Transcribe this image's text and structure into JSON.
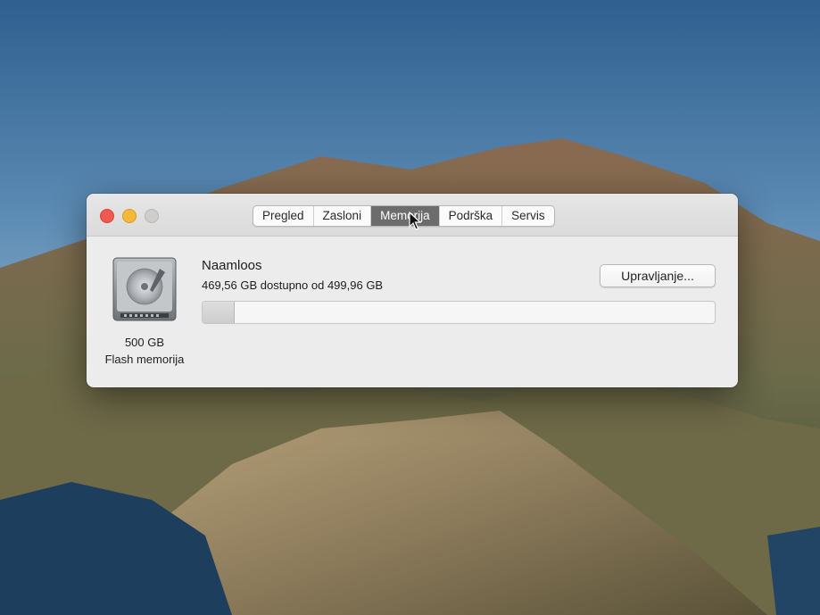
{
  "window": {
    "tabs": [
      {
        "label": "Pregled",
        "active": false
      },
      {
        "label": "Zasloni",
        "active": false
      },
      {
        "label": "Memorija",
        "active": true
      },
      {
        "label": "Podrška",
        "active": false
      },
      {
        "label": "Servis",
        "active": false
      }
    ]
  },
  "disk": {
    "icon": "hard-drive-icon",
    "size_label": "500 GB",
    "type_label": "Flash memorija"
  },
  "volume": {
    "name": "Naamloos",
    "availability": "469,56 GB dostupno od 499,96 GB",
    "used_fraction": 0.061
  },
  "manage_button": {
    "label": "Upravljanje..."
  },
  "colors": {
    "close": "#ee5a52",
    "minimize": "#f4b93a",
    "zoom_inactive": "#cfcecd",
    "active_tab": "#6d6c6c"
  }
}
